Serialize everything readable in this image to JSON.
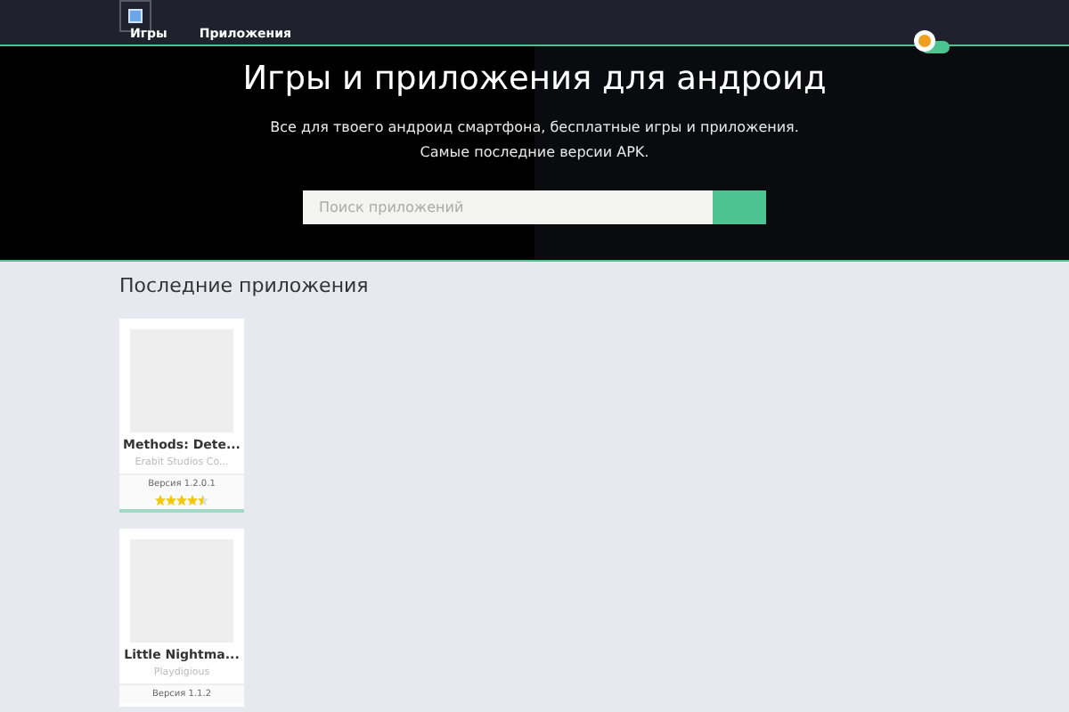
{
  "nav": {
    "items": [
      {
        "label": "Игры"
      },
      {
        "label": "Приложения"
      }
    ]
  },
  "hero": {
    "title": "Игры и приложения для андроид",
    "subtitle": "Все для твоего андроид смартфона, бесплатные игры и приложения. Самые последние версии APK.",
    "search": {
      "placeholder": "Поиск приложений"
    }
  },
  "section": {
    "title": "Последние приложения"
  },
  "apps": [
    {
      "name": "Methods: Dete...",
      "developer": "Erabit Studios Co...",
      "version": "Версия 1.2.0.1",
      "stars": 4.5
    },
    {
      "name": "Little Nightma...",
      "developer": "Playdigious",
      "version": "Версия 1.1.2"
    }
  ]
}
